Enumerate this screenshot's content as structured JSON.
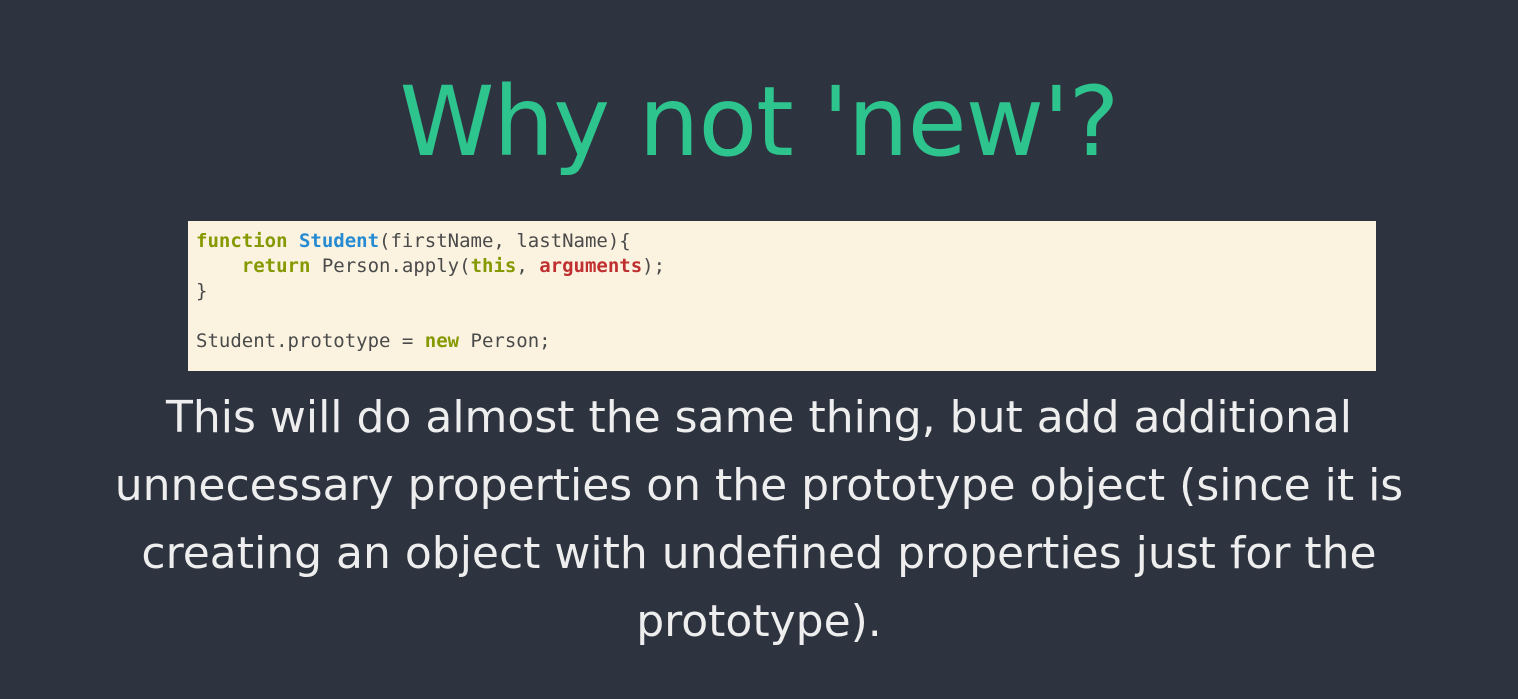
{
  "slide": {
    "title": "Why not 'new'?",
    "code": {
      "line1": {
        "kw_function": "function",
        "sp1": " ",
        "fn_name": "Student",
        "rest": "(firstName, lastName){"
      },
      "line2": {
        "indent": "    ",
        "kw_return": "return",
        "mid": " Person.apply(",
        "kw_this": "this",
        "comma": ", ",
        "arg_arguments": "arguments",
        "end": ");"
      },
      "line3": "}",
      "line5": {
        "start": "Student.prototype = ",
        "kw_new": "new",
        "end": " Person;"
      }
    },
    "body": "This will do almost the same thing, but add additional unnecessary properties on the prototype object (since it is creating an object with undefined properties just for the prototype)."
  },
  "colors": {
    "background": "#2d3440",
    "title": "#2ec48e",
    "code_background": "#fbf3e0",
    "keyword": "#859900",
    "function_name": "#268bd2",
    "arguments": "#c03030",
    "body_text": "#eeeeee"
  }
}
